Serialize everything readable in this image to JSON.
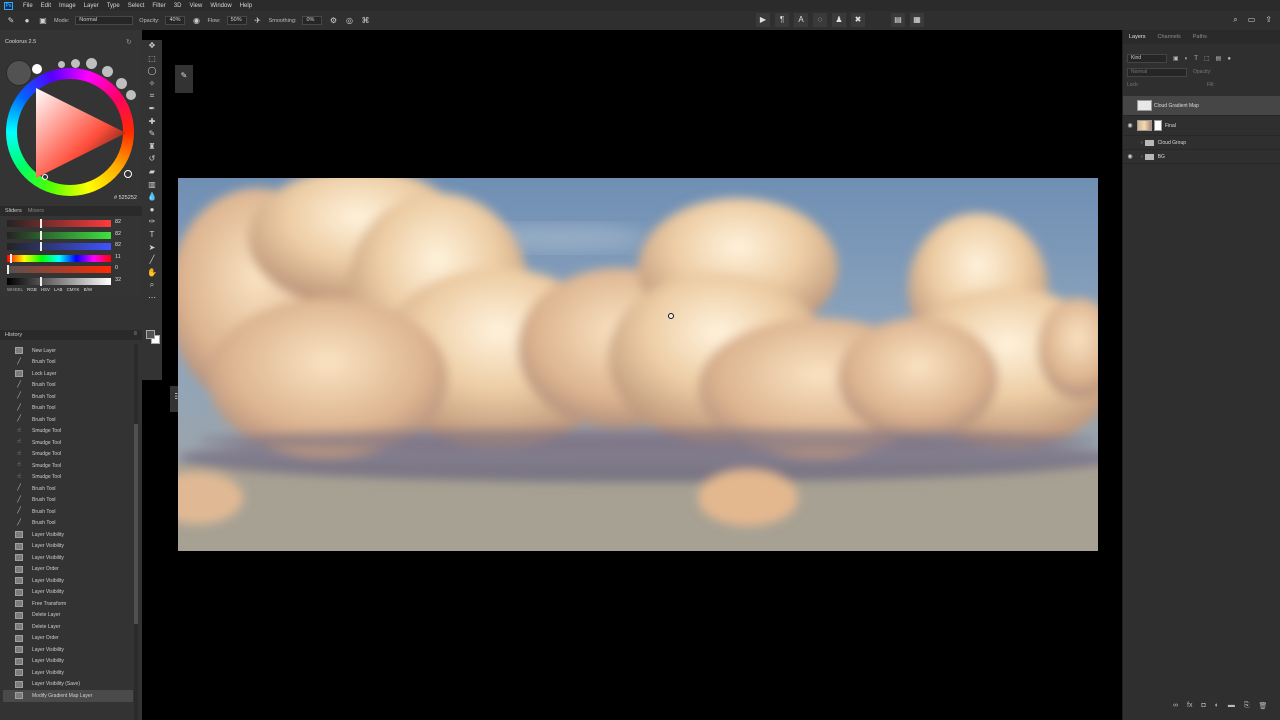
{
  "menu": [
    "File",
    "Edit",
    "Image",
    "Layer",
    "Type",
    "Select",
    "Filter",
    "3D",
    "View",
    "Window",
    "Help"
  ],
  "options": {
    "mode_label": "Mode:",
    "mode_value": "Normal",
    "opacity_label": "Opacity:",
    "opacity_value": "40%",
    "flow_label": "Flow:",
    "flow_value": "50%",
    "smoothing_label": "Smoothing:",
    "smoothing_value": "0%"
  },
  "coolorus": {
    "title": "Coolorus 2.5",
    "hex": "# 525252",
    "colors": {
      "foreground": "#525252",
      "hue": "#ff3a1e"
    }
  },
  "sliders": {
    "tabs": [
      "Sliders",
      "Mixers"
    ],
    "rows": [
      {
        "value": "82",
        "position": 0.32,
        "gradient": "linear-gradient(90deg,#232323,#ff3b3b)"
      },
      {
        "value": "82",
        "position": 0.32,
        "gradient": "linear-gradient(90deg,#232323,#3fe23f)"
      },
      {
        "value": "82",
        "position": 0.32,
        "gradient": "linear-gradient(90deg,#232323,#3f54ff)"
      },
      {
        "value": "11",
        "position": 0.03,
        "gradient": "linear-gradient(90deg,#ff0000,#ffff00,#00ff00,#00ffff,#0000ff,#ff00ff,#ff0000)"
      },
      {
        "value": "0",
        "position": 0.0,
        "gradient": "linear-gradient(90deg,#525252,#ff2a00)"
      },
      {
        "value": "32",
        "position": 0.32,
        "gradient": "linear-gradient(90deg,#000,#fff)"
      }
    ],
    "modes": [
      "WHEEL",
      "RGB",
      "HSV",
      "LAB",
      "CMYK",
      "B/W"
    ]
  },
  "history": {
    "title": "History",
    "items": [
      {
        "label": "New Layer",
        "icon": "layer"
      },
      {
        "label": "Brush Tool",
        "icon": "brush"
      },
      {
        "label": "Lock Layer",
        "icon": "layer"
      },
      {
        "label": "Brush Tool",
        "icon": "brush"
      },
      {
        "label": "Brush Tool",
        "icon": "brush"
      },
      {
        "label": "Brush Tool",
        "icon": "brush"
      },
      {
        "label": "Brush Tool",
        "icon": "brush"
      },
      {
        "label": "Smudge Tool",
        "icon": "smudge"
      },
      {
        "label": "Smudge Tool",
        "icon": "smudge"
      },
      {
        "label": "Smudge Tool",
        "icon": "smudge"
      },
      {
        "label": "Smudge Tool",
        "icon": "smudge"
      },
      {
        "label": "Smudge Tool",
        "icon": "smudge"
      },
      {
        "label": "Brush Tool",
        "icon": "brush"
      },
      {
        "label": "Brush Tool",
        "icon": "brush"
      },
      {
        "label": "Brush Tool",
        "icon": "brush"
      },
      {
        "label": "Brush Tool",
        "icon": "brush"
      },
      {
        "label": "Layer Visibility",
        "icon": "layer"
      },
      {
        "label": "Layer Visibility",
        "icon": "layer"
      },
      {
        "label": "Layer Visibility",
        "icon": "layer"
      },
      {
        "label": "Layer Order",
        "icon": "layer"
      },
      {
        "label": "Layer Visibility",
        "icon": "layer"
      },
      {
        "label": "Layer Visibility",
        "icon": "layer"
      },
      {
        "label": "Free Transform",
        "icon": "layer"
      },
      {
        "label": "Delete Layer",
        "icon": "layer"
      },
      {
        "label": "Delete Layer",
        "icon": "layer"
      },
      {
        "label": "Layer Order",
        "icon": "layer"
      },
      {
        "label": "Layer Visibility",
        "icon": "layer"
      },
      {
        "label": "Layer Visibility",
        "icon": "layer"
      },
      {
        "label": "Layer Visibility",
        "icon": "layer"
      },
      {
        "label": "Layer Visibility (Save)",
        "icon": "layer"
      },
      {
        "label": "Modify Gradient Map Layer",
        "icon": "layer",
        "selected": true
      }
    ]
  },
  "layers_panel": {
    "tabs": [
      "Layers",
      "Channels",
      "Paths"
    ],
    "kind": "Kind",
    "blend": "Normal",
    "opacity": "Opacity:",
    "lock": "Lock:",
    "fill": "Fill:",
    "layers": [
      {
        "name": "Cloud Gradient Map",
        "type": "adjustment",
        "visible": false,
        "selected": true
      },
      {
        "name": "Final",
        "type": "image",
        "visible": true
      },
      {
        "name": "Cloud Group",
        "type": "group",
        "visible": false
      },
      {
        "name": "BG",
        "type": "group",
        "visible": true
      }
    ]
  }
}
